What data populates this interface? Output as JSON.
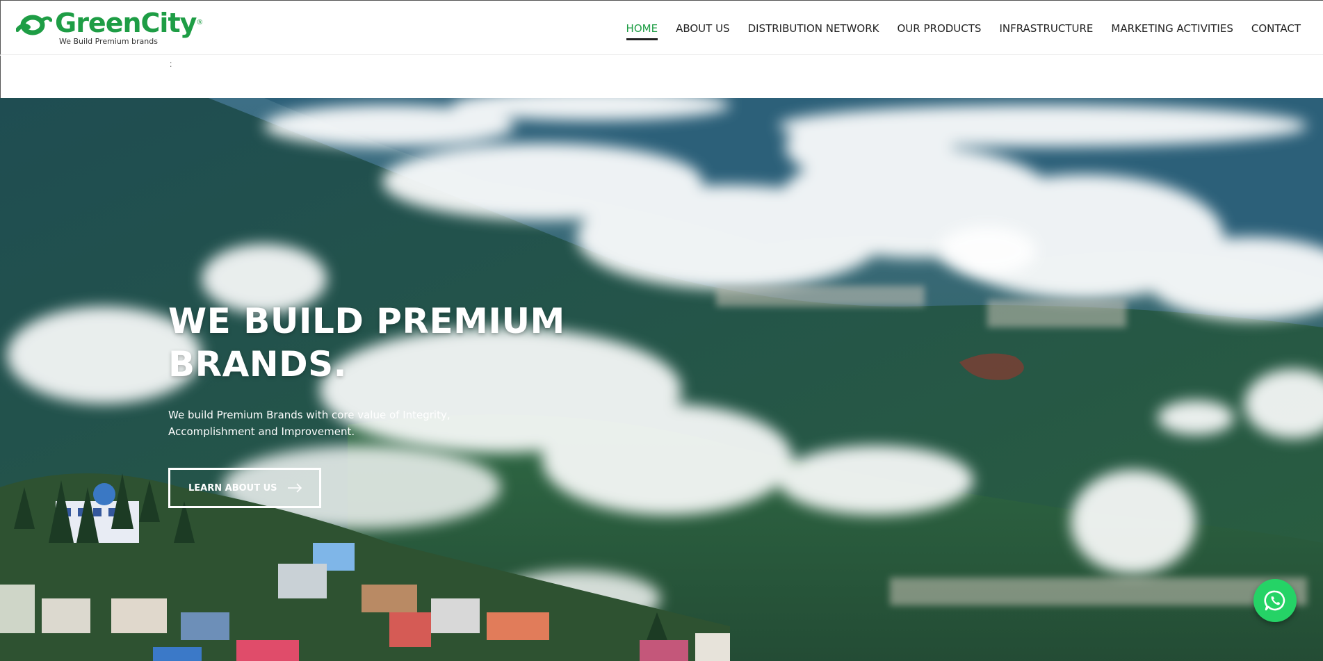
{
  "brand": {
    "name": "GreenCity",
    "registered_mark": "®",
    "tagline": "We Build Premium brands",
    "color": "#1e9d45"
  },
  "nav": {
    "items": [
      {
        "label": "HOME",
        "active": true
      },
      {
        "label": "ABOUT US"
      },
      {
        "label": "DISTRIBUTION NETWORK"
      },
      {
        "label": "OUR PRODUCTS"
      },
      {
        "label": "INFRASTRUCTURE"
      },
      {
        "label": "MARKETING ACTIVITIES"
      },
      {
        "label": "CONTACT"
      }
    ]
  },
  "subbar": {
    "text": ":"
  },
  "hero": {
    "title_line1": "WE BUILD PREMIUM",
    "title_line2": "BRANDS.",
    "description": "We build Premium Brands with core value of Integrity, Accomplishment and Improvement.",
    "button_label": "LEARN ABOUT US",
    "button_icon": "arrow-right-icon",
    "background": "mountain-clouds-town-photo"
  },
  "whatsapp": {
    "icon": "whatsapp-icon",
    "color": "#25d366"
  }
}
